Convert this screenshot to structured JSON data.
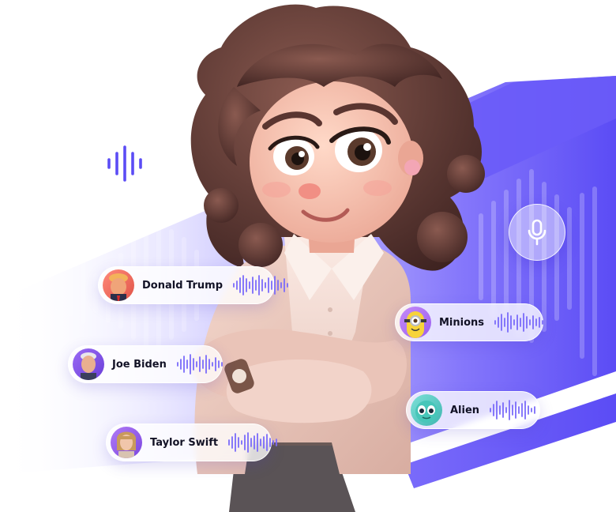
{
  "accent_colors": {
    "primary": "#5b4cf5",
    "light": "#cfc9ff",
    "mid": "#8c7dfb"
  },
  "voices": [
    {
      "name": "Donald Trump",
      "avatar_icon": "donald-trump-avatar"
    },
    {
      "name": "Joe Biden",
      "avatar_icon": "joe-biden-avatar"
    },
    {
      "name": "Taylor Swift",
      "avatar_icon": "taylor-swift-avatar"
    },
    {
      "name": "Minions",
      "avatar_icon": "minion-avatar"
    },
    {
      "name": "Alien",
      "avatar_icon": "alien-avatar"
    }
  ],
  "icons": [
    "sound-wave-icon",
    "microphone-icon",
    "waveform-icon"
  ]
}
